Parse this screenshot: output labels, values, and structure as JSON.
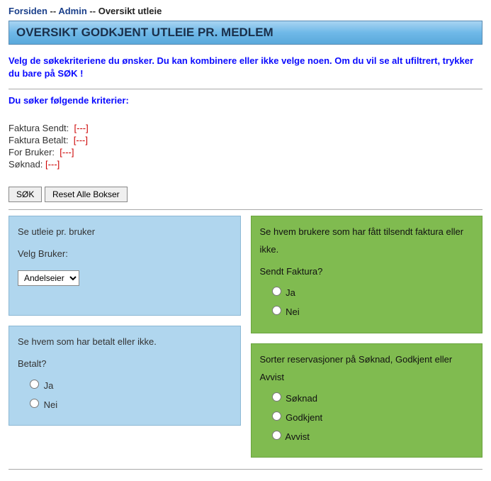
{
  "breadcrumb": {
    "home": "Forsiden",
    "admin": "Admin",
    "current": "Oversikt utleie",
    "sep": "--"
  },
  "title": "OVERSIKT GODKJENT UTLEIE PR. MEDLEM",
  "instructions": "Velg de søkekriteriene du ønsker. Du kan kombinere eller ikke velge noen. Om du vil se alt ufiltrert, trykker du bare på SØK !",
  "criteria": {
    "heading": "Du søker følgende kriterier:",
    "lines": [
      {
        "label": "Faktura Sendt:",
        "value": "[---]"
      },
      {
        "label": "Faktura Betalt:",
        "value": "[---]"
      },
      {
        "label": "For Bruker:",
        "value": "[---]"
      },
      {
        "label": "Søknad:",
        "value": "[---]"
      }
    ]
  },
  "buttons": {
    "search": "SØK",
    "reset": "Reset Alle Bokser"
  },
  "panel_user": {
    "heading": "Se utleie pr. bruker",
    "label": "Velg Bruker:",
    "selected": "Andelseier"
  },
  "panel_paid": {
    "heading": "Se hvem som har betalt eller ikke.",
    "label": "Betalt?",
    "opt_yes": "Ja",
    "opt_no": "Nei"
  },
  "panel_sent": {
    "heading": "Se hvem brukere som har fått tilsendt faktura eller ikke.",
    "label": "Sendt Faktura?",
    "opt_yes": "Ja",
    "opt_no": "Nei"
  },
  "panel_sort": {
    "heading": "Sorter reservasjoner på Søknad, Godkjent eller Avvist",
    "opt_soknad": "Søknad",
    "opt_godkjent": "Godkjent",
    "opt_avvist": "Avvist"
  }
}
